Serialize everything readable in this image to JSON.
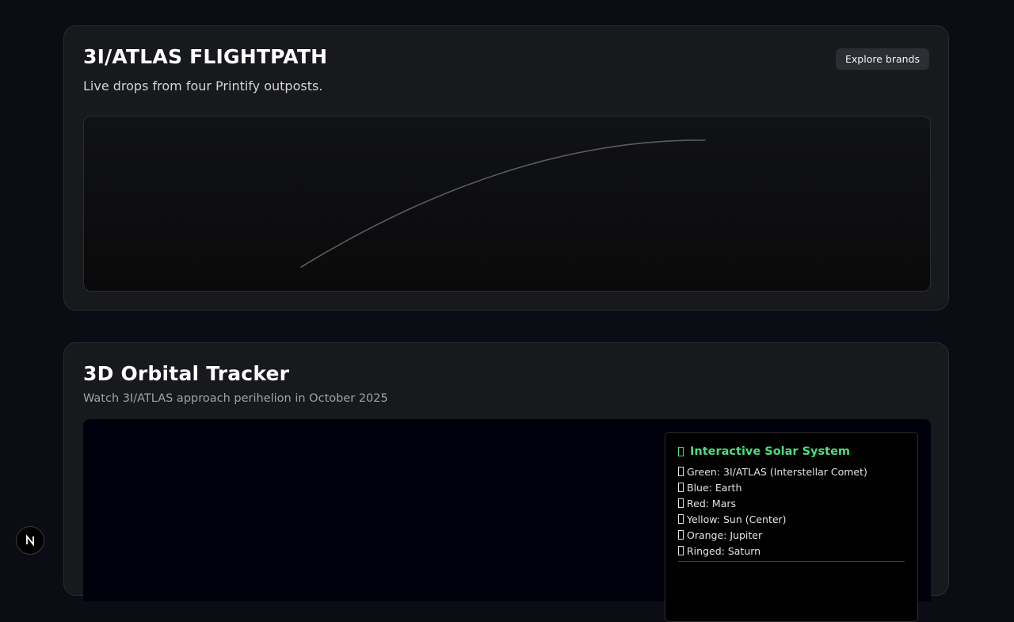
{
  "flightpath": {
    "title": "3I/ATLAS FLIGHTPATH",
    "subtitle": "Live drops from four Printify outposts.",
    "explore_button": "Explore brands"
  },
  "orbital": {
    "title": "3D Orbital Tracker",
    "subtitle": "Watch 3I/ATLAS approach perihelion in October 2025",
    "legend": {
      "title": "Interactive Solar System",
      "title_color": "#4ade80",
      "items": [
        {
          "label": "Green: 3I/ATLAS (Interstellar Comet)"
        },
        {
          "label": "Blue: Earth"
        },
        {
          "label": "Red: Mars"
        },
        {
          "label": "Yellow: Sun (Center)"
        },
        {
          "label": "Orange: Jupiter"
        },
        {
          "label": "Ringed: Saturn"
        }
      ]
    }
  },
  "badge": {
    "icon": "nextjs-logo-icon",
    "letter": "N"
  },
  "colors": {
    "page_background": "#0b0c14",
    "card_background": "#18191d",
    "flightpath_line": "#5b5c62",
    "orbital_viewport": "#01010d"
  }
}
